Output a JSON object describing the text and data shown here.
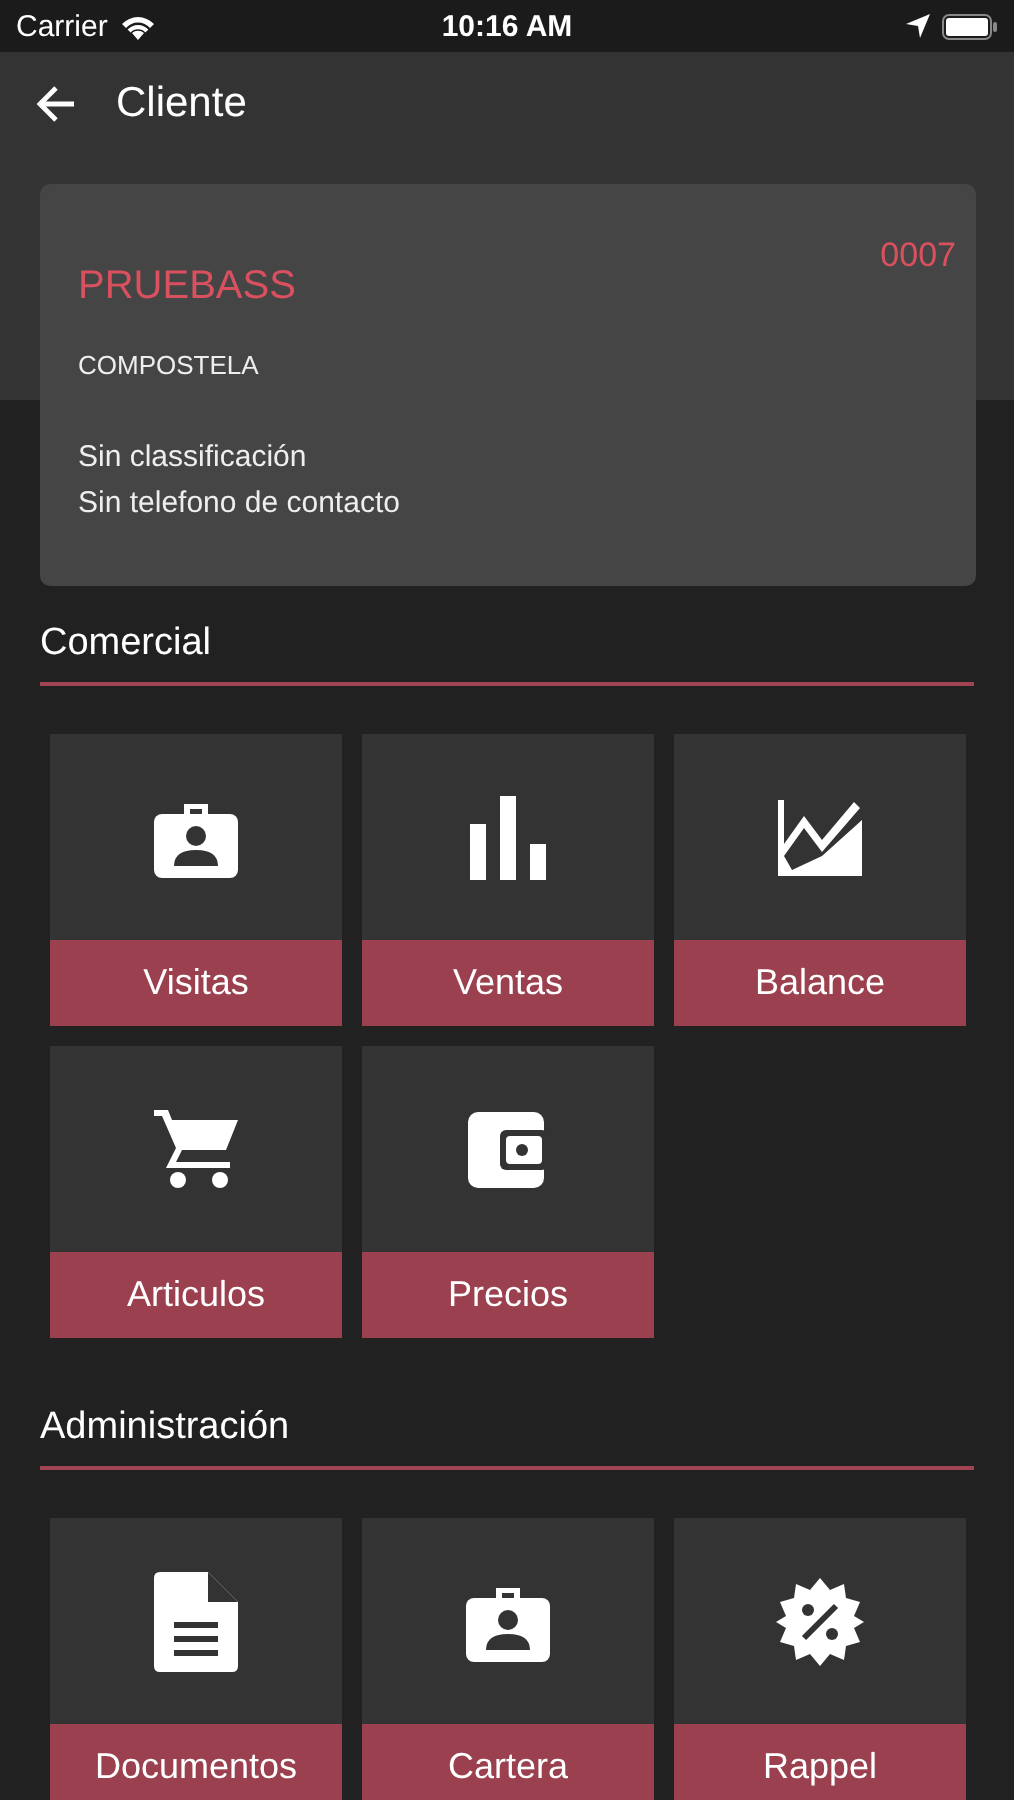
{
  "status_bar": {
    "carrier": "Carrier",
    "time": "10:16 AM"
  },
  "app_bar": {
    "title": "Cliente"
  },
  "client": {
    "name": "PRUEBASS",
    "code": "0007",
    "city": "COMPOSTELA",
    "lines": [
      "Sin classificación",
      "Sin telefono de contacto"
    ]
  },
  "sections": [
    {
      "title": "Comercial",
      "tiles": [
        {
          "label": "Visitas",
          "kind": "badge"
        },
        {
          "label": "Ventas",
          "kind": "bars"
        },
        {
          "label": "Balance",
          "kind": "chart"
        },
        {
          "label": "Articulos",
          "kind": "cart"
        },
        {
          "label": "Precios",
          "kind": "wallet"
        }
      ]
    },
    {
      "title": "Administración",
      "tiles": [
        {
          "label": "Documentos",
          "kind": "document"
        },
        {
          "label": "Cartera",
          "kind": "badge"
        },
        {
          "label": "Rappel",
          "kind": "percent"
        }
      ]
    }
  ]
}
